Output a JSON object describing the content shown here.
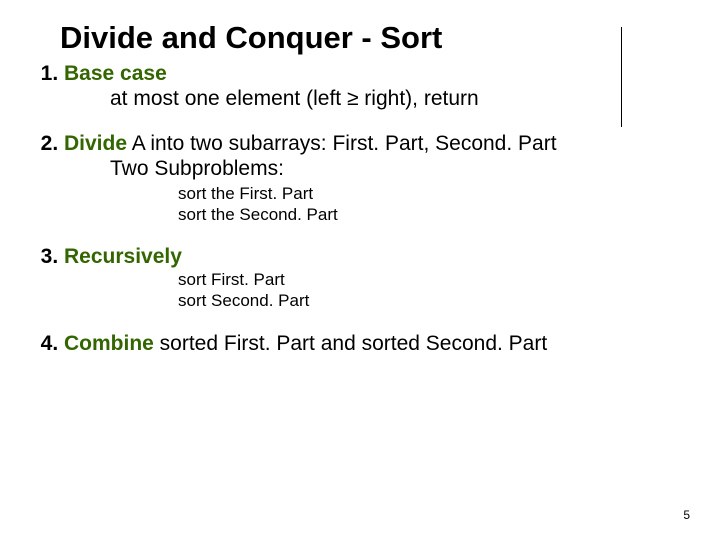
{
  "title": "Divide and Conquer - Sort",
  "items": [
    {
      "head": "Base case",
      "sub1": [
        "at most one element (left ≥ right),  return"
      ],
      "sub2": []
    },
    {
      "head": "Divide",
      "head_tail": " A into two subarrays: First. Part, Second. Part",
      "sub1": [
        "Two Subproblems:"
      ],
      "sub2": [
        "sort the First. Part",
        "sort the Second. Part"
      ]
    },
    {
      "head": "Recursively",
      "sub1": [],
      "sub2": [
        "sort First. Part",
        "sort Second. Part"
      ]
    },
    {
      "head": "Combine",
      "head_tail": " sorted First. Part  and sorted Second. Part",
      "sub1": [],
      "sub2": []
    }
  ],
  "page_number": "5"
}
